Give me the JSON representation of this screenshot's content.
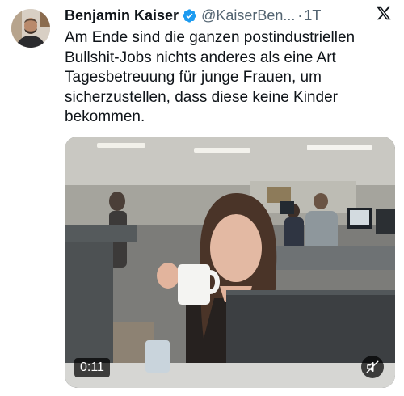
{
  "author": {
    "display_name": "Benjamin Kaiser",
    "handle": "@KaiserBen...",
    "separator": "·",
    "time": "1T",
    "verified": true,
    "verified_color": "#1d9bf0"
  },
  "tweet": {
    "text": "Am Ende sind die ganzen postindustriellen Bullshit-Jobs nichts anderes als eine Art Tagesbetreuung für junge Frauen, um sicherzustellen, dass diese keine Kinder bekommen."
  },
  "media": {
    "type": "video",
    "duration": "0:11",
    "muted": true
  },
  "icons": {
    "brand": "x-logo-icon",
    "verified": "verified-badge-icon",
    "mute": "muted-speaker-icon"
  },
  "colors": {
    "text_primary": "#0f1419",
    "text_secondary": "#536471"
  }
}
